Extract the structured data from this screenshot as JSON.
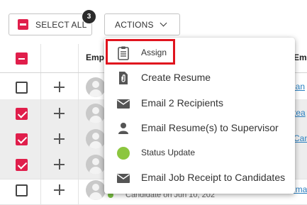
{
  "toolbar": {
    "select_all_label": "SELECT ALL",
    "selected_count": "3",
    "actions_label": "ACTIONS"
  },
  "grid": {
    "header": {
      "col_name_fragment": "Emp",
      "col_right_fragment": "Em"
    },
    "rows": [
      {
        "checked": false,
        "link_fragment": "lan"
      },
      {
        "checked": true,
        "link_fragment": "tea"
      },
      {
        "checked": true,
        "link_fragment": "Can"
      },
      {
        "checked": true,
        "link_fragment": ""
      },
      {
        "checked": false,
        "link_fragment": "ima",
        "subtext": "Candidate on Jun 10, 202"
      }
    ]
  },
  "menu": {
    "items": [
      {
        "label": "Assign",
        "icon": "clipboard-icon"
      },
      {
        "label": "Create Resume",
        "icon": "resume-attach-icon"
      },
      {
        "label": "Email 2 Recipients",
        "icon": "envelope-icon"
      },
      {
        "label": "Email Resume(s) to Supervisor",
        "icon": "person-icon"
      },
      {
        "label": "Status Update",
        "icon": "green-status-dot-icon"
      },
      {
        "label": "Email Job Receipt to Candidates",
        "icon": "envelope-icon"
      }
    ]
  },
  "colors": {
    "accent_red": "#e01e4b",
    "highlight_border": "#e0141e",
    "status_green": "#8cc63f",
    "link_blue": "#2a7fc0"
  }
}
